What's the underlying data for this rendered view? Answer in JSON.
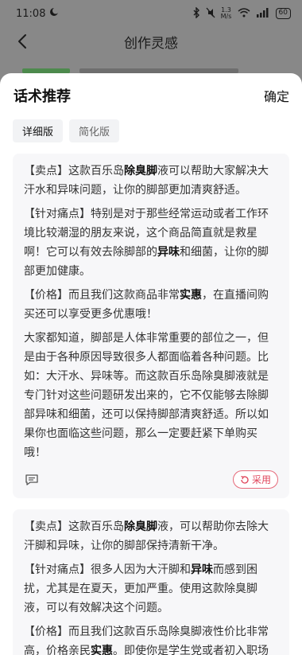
{
  "status_bar": {
    "time": "11:08",
    "network_speed": "1.3\nM/s",
    "battery": "60"
  },
  "nav": {
    "title": "创作灵感"
  },
  "sheet": {
    "title": "话术推荐",
    "confirm_label": "确定",
    "tabs": [
      {
        "label": "详细版",
        "active": true
      },
      {
        "label": "简化版",
        "active": false
      }
    ],
    "adopt_label": "采用",
    "cards": [
      {
        "paragraphs": [
          [
            {
              "t": "【卖点】这款百乐岛"
            },
            {
              "t": "除臭脚",
              "b": true
            },
            {
              "t": "液可以帮助大家解决大汗水和异味问题，让你的脚部更加清爽舒适。"
            }
          ],
          [
            {
              "t": "【针对痛点】特别是对于那些经常运动或者工作环境比较潮湿的朋友来说，这个商品简直就是救星啊！它可以有效去除脚部的"
            },
            {
              "t": "异味",
              "b": true
            },
            {
              "t": "和细菌，让你的脚部更加健康。"
            }
          ],
          [
            {
              "t": "【价格】而且我们这款商品非常"
            },
            {
              "t": "实惠",
              "b": true
            },
            {
              "t": "，在直播间购买还可以享受更多优惠哦！"
            }
          ],
          [
            {
              "t": "大家都知道，脚部是人体非常重要的部位之一，但是由于各种原因导致很多人都面临着各种问题。比如：大汗水、异味等。而这款百乐岛除臭脚液就是专门针对这些问题研发出来的，它不仅能够去除脚部异味和细菌，还可以保持脚部清爽舒适。所以如果你也面临这些问题，那么一定要赶紧下单购买哦！"
            }
          ]
        ]
      },
      {
        "paragraphs": [
          [
            {
              "t": "【卖点】这款百乐岛"
            },
            {
              "t": "除臭脚",
              "b": true
            },
            {
              "t": "液，可以帮助你去除大汗脚和异味，让你的脚部保持清新干净。"
            }
          ],
          [
            {
              "t": "【针对痛点】很多人因为大汗脚和"
            },
            {
              "t": "异味",
              "b": true
            },
            {
              "t": "而感到困扰，尤其是在夏天，更加严重。使用这款除臭脚液，可以有效解决这个问题。"
            }
          ],
          [
            {
              "t": "【价格】而且我们这款百乐岛除臭脚液性价比非常高，价格亲民"
            },
            {
              "t": "实惠",
              "b": true
            },
            {
              "t": "。即使你是学生党或者初入职场"
            }
          ]
        ]
      }
    ]
  }
}
